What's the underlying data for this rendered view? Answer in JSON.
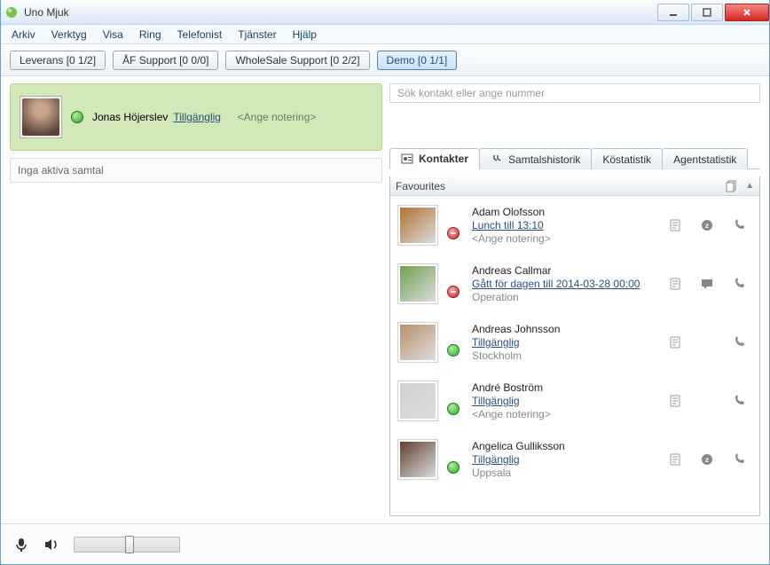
{
  "window": {
    "title": "Uno Mjuk"
  },
  "menu": [
    "Arkiv",
    "Verktyg",
    "Visa",
    "Ring",
    "Telefonist",
    "Tjänster",
    "Hjälp"
  ],
  "queues": [
    {
      "label": "Leverans [0 1/2]",
      "active": false
    },
    {
      "label": "ÅF Support [0 0/0]",
      "active": false
    },
    {
      "label": "WholeSale Support [0 2/2]",
      "active": false
    },
    {
      "label": "Demo [0 1/1]",
      "active": true
    }
  ],
  "me": {
    "name": "Jonas Höjerslev",
    "status_link": "Tillgänglig",
    "note_placeholder": "<Ange notering>",
    "status": "green"
  },
  "calls": {
    "empty_text": "Inga aktiva samtal"
  },
  "search": {
    "placeholder": "Sök kontakt eller ange nummer"
  },
  "tabs": {
    "items": [
      "Kontakter",
      "Samtalshistorik",
      "Köstatistik",
      "Agentstatistik"
    ],
    "active_index": 0
  },
  "list": {
    "header": "Favourites",
    "contacts": [
      {
        "name": "Adam Olofsson",
        "status": "red",
        "status_text": "Lunch till 13:10",
        "note": "<Ange notering>",
        "icons": [
          "note",
          "sleep",
          "call"
        ]
      },
      {
        "name": "Andreas Callmar",
        "status": "red",
        "status_text": "Gått för dagen till 2014-03-28 00:00",
        "note": "Operation",
        "icons": [
          "note",
          "chat",
          "call"
        ]
      },
      {
        "name": "Andreas Johnsson",
        "status": "green",
        "status_text": "Tillgänglig",
        "note": "Stockholm",
        "icons": [
          "note",
          "",
          "call"
        ]
      },
      {
        "name": "André Boström",
        "status": "green",
        "status_text": "Tillgänglig",
        "note": "<Ange notering>",
        "icons": [
          "note",
          "",
          "call"
        ]
      },
      {
        "name": "Angelica Gulliksson",
        "status": "green",
        "status_text": "Tillgänglig",
        "note": "Uppsala",
        "icons": [
          "note",
          "sleep",
          "call"
        ]
      }
    ]
  }
}
